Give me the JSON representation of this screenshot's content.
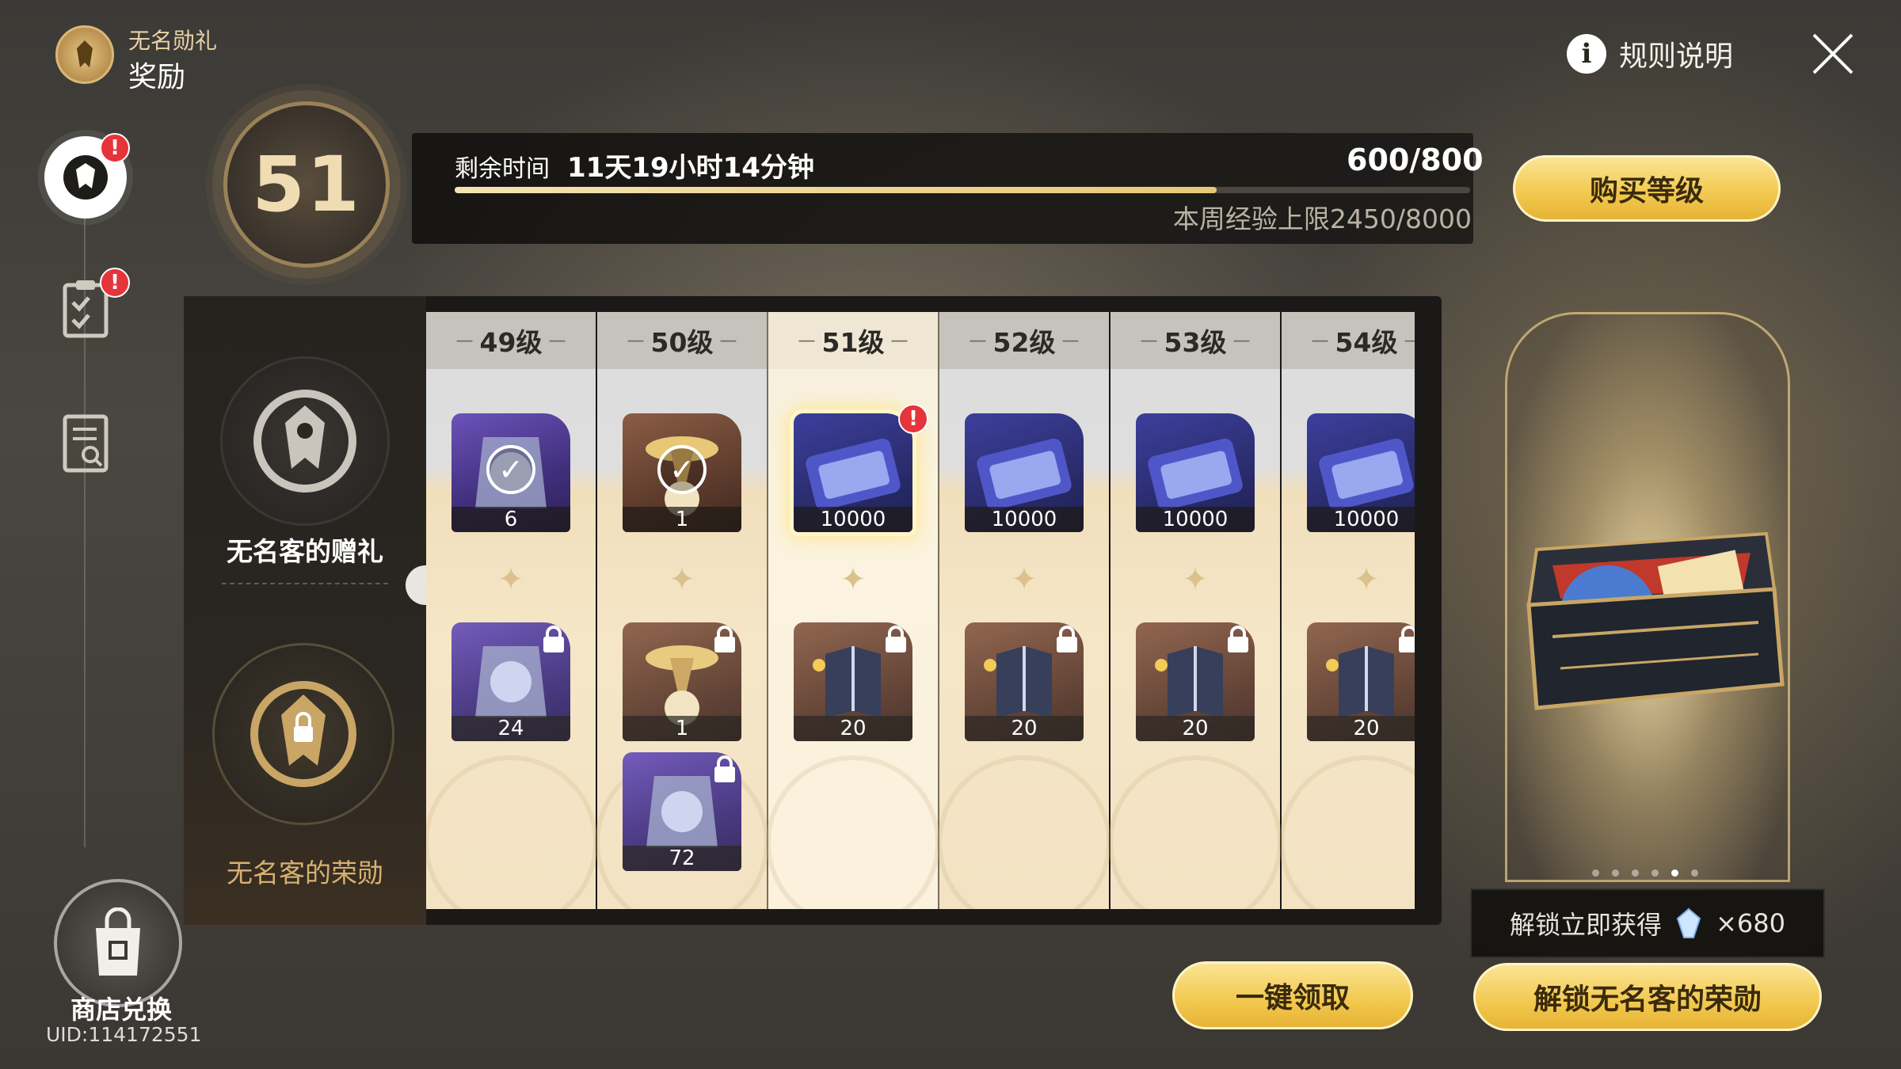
{
  "header": {
    "subtitle": "无名勋礼",
    "title": "奖励",
    "rules_label": "规则说明"
  },
  "level": {
    "current": "51",
    "remaining_label": "剩余时间",
    "remaining_value": "11天19小时14分钟",
    "exp_text": "600/800",
    "exp_progress": 0.75,
    "weekly_cap_text": "本周经验上限2450/8000",
    "buy_button": "购买等级"
  },
  "tiers": {
    "free_label": "无名客的赠礼",
    "paid_label": "无名客的荣勋"
  },
  "columns": [
    {
      "label": "49级",
      "free": {
        "count": "6",
        "color": "purple",
        "claimed": true
      },
      "paid": [
        {
          "count": "24",
          "color": "purple"
        }
      ]
    },
    {
      "label": "50级",
      "free": {
        "count": "1",
        "color": "brown",
        "claimed": true
      },
      "paid": [
        {
          "count": "1",
          "color": "brown"
        },
        {
          "count": "72",
          "color": "purple"
        }
      ]
    },
    {
      "label": "51级",
      "free": {
        "count": "10000",
        "color": "blue",
        "claimed": false
      },
      "paid": [
        {
          "count": "20",
          "color": "brown"
        }
      ]
    },
    {
      "label": "52级",
      "free": {
        "count": "10000",
        "color": "blue",
        "claimed": false
      },
      "paid": [
        {
          "count": "20",
          "color": "brown"
        }
      ]
    },
    {
      "label": "53级",
      "free": {
        "count": "10000",
        "color": "blue",
        "claimed": false
      },
      "paid": [
        {
          "count": "20",
          "color": "brown"
        }
      ]
    },
    {
      "label": "54级",
      "free": {
        "count": "10000",
        "color": "blue",
        "claimed": false
      },
      "paid": [
        {
          "count": "20",
          "color": "brown"
        }
      ]
    }
  ],
  "preview": {
    "unlock_info_label": "解锁立即获得",
    "unlock_info_amount": "×680",
    "unlock_button": "解锁无名客的荣勋",
    "page_count": 6,
    "active_page": 5
  },
  "actions": {
    "claim_all": "一键领取"
  },
  "sidebar": {
    "shop_label": "商店兑换",
    "uid": "UID:114172551"
  },
  "colors": {
    "accent_gold": "#f2c84e",
    "badge_red": "#e5343a"
  }
}
